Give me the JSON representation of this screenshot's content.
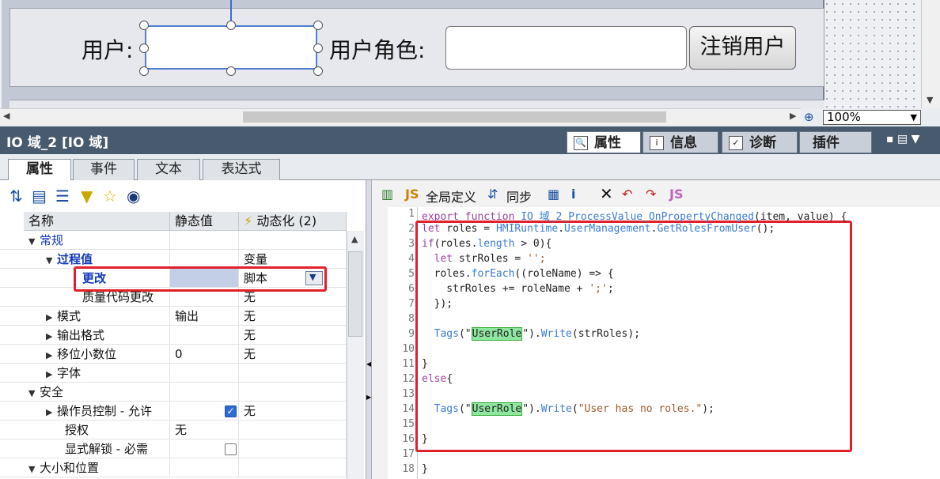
{
  "canvas": {
    "user_label": "用户:",
    "role_label": "用户角色:",
    "logout_button": "注销用户",
    "zoom": "100%"
  },
  "inspector": {
    "title": "IO 域_2 [IO 域]",
    "tabs": [
      "属性",
      "信息",
      "诊断",
      "插件"
    ],
    "sub_tabs": [
      "属性",
      "事件",
      "文本",
      "表达式"
    ]
  },
  "grid": {
    "headers": {
      "name": "名称",
      "static": "静态值",
      "dynamic": "动态化 (2)"
    },
    "rows": [
      {
        "name": "常规",
        "static": "",
        "dynamic": ""
      },
      {
        "name": "过程值",
        "static": "",
        "dynamic": "变量"
      },
      {
        "name": "更改",
        "static": "",
        "dynamic": "脚本"
      },
      {
        "name": "质量代码更改",
        "static": "",
        "dynamic": "无"
      },
      {
        "name": "模式",
        "static": "输出",
        "dynamic": "无"
      },
      {
        "name": "输出格式",
        "static": "",
        "dynamic": "无"
      },
      {
        "name": "移位小数位",
        "static": "0",
        "dynamic": "无"
      },
      {
        "name": "字体",
        "static": "",
        "dynamic": ""
      },
      {
        "name": "安全",
        "static": "",
        "dynamic": ""
      },
      {
        "name": "操作员控制 - 允许",
        "static": "",
        "dynamic": "无"
      },
      {
        "name": "授权",
        "static": "无",
        "dynamic": ""
      },
      {
        "name": "显式解锁 - 必需",
        "static": "",
        "dynamic": ""
      },
      {
        "name": "大小和位置",
        "static": "",
        "dynamic": ""
      }
    ]
  },
  "editor": {
    "toolbar": {
      "global_def": "全局定义",
      "sync": "同步"
    },
    "line_numbers": [
      "1",
      "2",
      "3",
      "4",
      "5",
      "6",
      "7",
      "8",
      "9",
      "10",
      "11",
      "12",
      "13",
      "14",
      "15",
      "16",
      "17",
      "18"
    ],
    "lines": [
      "export function IO 域_2_ProcessValue_OnPropertyChanged(item, value) {",
      "let roles = HMIRuntime.UserManagement.GetRolesFromUser();",
      "if(roles.length > 0){",
      "  let strRoles = '';",
      "  roles.forEach((roleName) => {",
      "    strRoles += roleName + ';';",
      "  });",
      "",
      "  Tags(\"UserRole\").Write(strRoles);",
      "",
      "}",
      "else{",
      "",
      "  Tags(\"UserRole\").Write(\"User has no roles.\");",
      "",
      "}",
      "",
      "}"
    ]
  },
  "colors": {
    "accent_red": "#e0202a",
    "header_bg": "#485a6e",
    "selection_blue": "#4e7fd1"
  }
}
